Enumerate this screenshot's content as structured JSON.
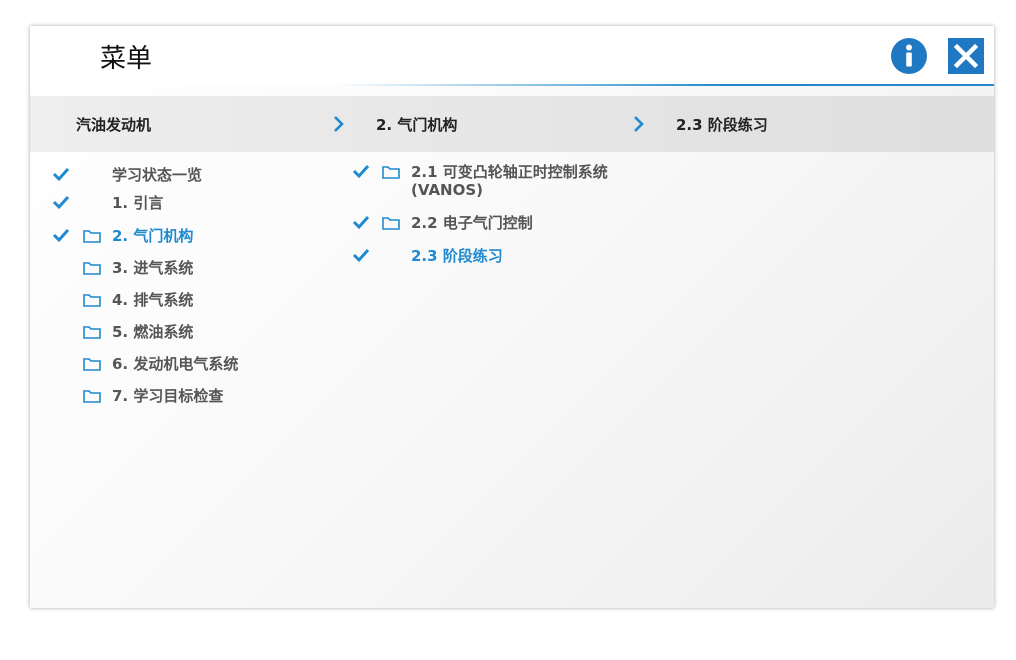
{
  "header": {
    "title": "菜单"
  },
  "breadcrumb": {
    "items": [
      "汽油发动机",
      "2. 气门机构",
      "2.3 阶段练习"
    ]
  },
  "main_menu": {
    "items": [
      {
        "label": "学习状态一览",
        "checked": true,
        "folder": false,
        "active": false
      },
      {
        "label": "1. 引言",
        "checked": true,
        "folder": false,
        "active": false
      },
      {
        "label": "2. 气门机构",
        "checked": true,
        "folder": true,
        "active": true
      },
      {
        "label": "3. 进气系统",
        "checked": false,
        "folder": true,
        "active": false
      },
      {
        "label": "4. 排气系统",
        "checked": false,
        "folder": true,
        "active": false
      },
      {
        "label": "5. 燃油系统",
        "checked": false,
        "folder": true,
        "active": false
      },
      {
        "label": "6. 发动机电气系统",
        "checked": false,
        "folder": true,
        "active": false
      },
      {
        "label": "7. 学习目标检查",
        "checked": false,
        "folder": true,
        "active": false
      }
    ]
  },
  "sub_menu": {
    "items": [
      {
        "label": "2.1 可变凸轮轴正时控制系统",
        "label_line2": "(VANOS)",
        "checked": true,
        "folder": true,
        "active": false
      },
      {
        "label": "2.2 电子气门控制",
        "checked": true,
        "folder": true,
        "active": false
      },
      {
        "label": "2.3 阶段练习",
        "checked": true,
        "folder": false,
        "active": true
      }
    ]
  },
  "colors": {
    "accent": "#1f8ad0",
    "icon_blue": "#1f79c2",
    "text": "#555555"
  },
  "icons": {
    "info": "info-icon",
    "close": "close-icon",
    "check": "check-icon",
    "folder": "folder-icon",
    "chevron": "chevron-right-icon"
  }
}
